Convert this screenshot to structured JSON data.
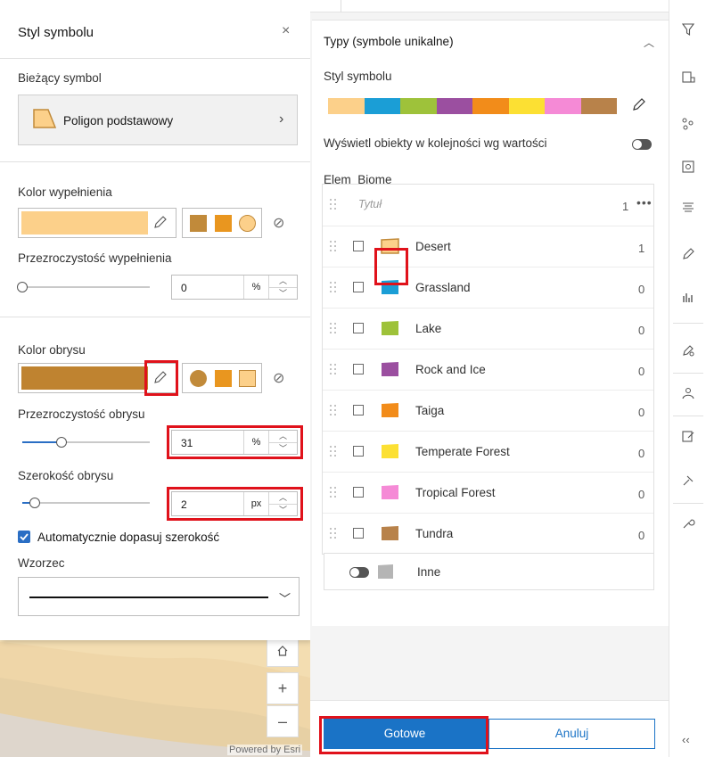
{
  "map": {
    "powered_by": "Powered by Esri",
    "zoom_in": "+",
    "zoom_out": "–"
  },
  "symbol_panel": {
    "title": "Styl symbolu",
    "close": "×",
    "current_symbol_label": "Bieżący symbol",
    "current_symbol_name": "Poligon podstawowy",
    "fill_color_label": "Kolor wypełnienia",
    "fill_color": "#fcd08a",
    "fill_presets": [
      "#c18a3a",
      "#e9961f",
      "#fcd08a"
    ],
    "fill_transparency_label": "Przezroczystość wypełnienia",
    "fill_transparency": {
      "value": "0",
      "unit": "%",
      "fraction": 0.0
    },
    "outline_color_label": "Kolor obrysu",
    "outline_color": "#bf8330",
    "outline_presets": [
      "#c18a3a",
      "#e9961f",
      "#fcd08a"
    ],
    "outline_transparency_label": "Przezroczystość obrysu",
    "outline_transparency": {
      "value": "31",
      "unit": "%",
      "fraction": 0.31
    },
    "outline_width_label": "Szerokość obrysu",
    "outline_width": {
      "value": "2",
      "unit": "px",
      "fraction": 0.1
    },
    "auto_adjust_label": "Automatycznie dopasuj szerokość",
    "auto_adjust_checked": true,
    "pattern_label": "Wzorzec"
  },
  "types_panel": {
    "title": "Typy (symbole unikalne)",
    "symbol_style_label": "Styl symbolu",
    "ramp_colors": [
      "#fcd08a",
      "#1b9ed6",
      "#9ec23a",
      "#9b4fa0",
      "#f28c1a",
      "#fce033",
      "#f58ad6",
      "#b8824a"
    ],
    "order_label": "Wyświetl obiekty w kolejności wg wartości",
    "field_name": "Elem_Biome",
    "title_row": {
      "placeholder": "Tytuł",
      "count": "1",
      "more": "•••"
    },
    "items": [
      {
        "name": "Desert",
        "count": "1",
        "color": "#fcd08a"
      },
      {
        "name": "Grassland",
        "count": "0",
        "color": "#1b9ed6"
      },
      {
        "name": "Lake",
        "count": "0",
        "color": "#9ec23a"
      },
      {
        "name": "Rock and Ice",
        "count": "0",
        "color": "#9b4fa0"
      },
      {
        "name": "Taiga",
        "count": "0",
        "color": "#f28c1a"
      },
      {
        "name": "Temperate Forest",
        "count": "0",
        "color": "#fce033"
      },
      {
        "name": "Tropical Forest",
        "count": "0",
        "color": "#f58ad6"
      },
      {
        "name": "Tundra",
        "count": "0",
        "color": "#b8824a"
      }
    ],
    "other_label": "Inne",
    "done_button": "Gotowe",
    "cancel_button": "Anuluj"
  },
  "toolbar": {
    "icons": [
      "filter-icon",
      "map-properties-icon",
      "clustering-icon",
      "popups-icon",
      "fields-icon",
      "styles-icon",
      "charts-icon",
      "sketch-icon",
      "analysis-icon",
      "edit-icon",
      "pin-icon",
      "settings-icon"
    ],
    "collapse": "‹‹"
  }
}
